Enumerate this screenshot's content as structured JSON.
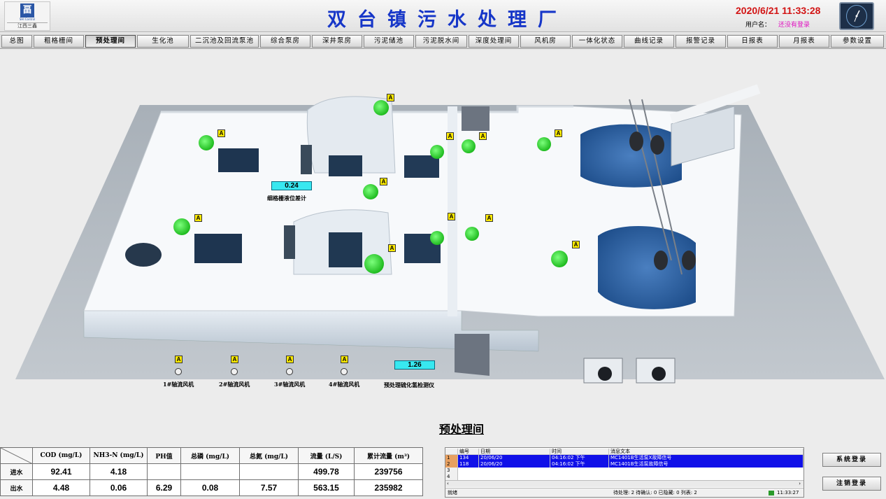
{
  "header": {
    "logo_sub": "SHI Control",
    "logo_name": "江西三鑫",
    "title": "双台镇污水处理厂",
    "datetime": "2020/6/21 11:33:28",
    "user_label": "用户名：",
    "user_value": "还没有登录"
  },
  "nav": [
    {
      "label": "总图",
      "active": false
    },
    {
      "label": "粗格栅间",
      "active": false
    },
    {
      "label": "预处理间",
      "active": true
    },
    {
      "label": "生化池",
      "active": false
    },
    {
      "label": "二沉池及回流泵池",
      "active": false
    },
    {
      "label": "综合泵房",
      "active": false
    },
    {
      "label": "深井泵房",
      "active": false
    },
    {
      "label": "污泥储池",
      "active": false
    },
    {
      "label": "污泥脱水间",
      "active": false
    },
    {
      "label": "深度处理间",
      "active": false
    },
    {
      "label": "风机房",
      "active": false
    },
    {
      "label": "一体化状态",
      "active": false
    },
    {
      "label": "曲线记录",
      "active": false
    },
    {
      "label": "报警记录",
      "active": false
    },
    {
      "label": "日报表",
      "active": false
    },
    {
      "label": "月报表",
      "active": false
    },
    {
      "label": "参数设置",
      "active": false
    }
  ],
  "scene": {
    "alarm_badge": "A",
    "level_diff_value": "0.24",
    "level_diff_label": "细格栅液位差计",
    "h2s_value": "1.26",
    "h2s_label": "预处理硫化氢检测仪",
    "fans": [
      {
        "label": "1#轴流风机"
      },
      {
        "label": "2#轴流风机"
      },
      {
        "label": "3#轴流风机"
      },
      {
        "label": "4#轴流风机"
      }
    ],
    "page_title": "预处理间"
  },
  "water_quality": {
    "headers": [
      "COD (mg/L)",
      "NH3-N (mg/L)",
      "PH值",
      "总磷 (mg/L)",
      "总氮 (mg/L)",
      "流量 (L/S)",
      "累计流量 (m³)"
    ],
    "rows": [
      {
        "label": "进水",
        "values": [
          "92.41",
          "4.18",
          "",
          "",
          "",
          "499.78",
          "239756"
        ]
      },
      {
        "label": "出水",
        "values": [
          "4.48",
          "0.06",
          "6.29",
          "0.08",
          "7.57",
          "563.15",
          "235982"
        ]
      }
    ]
  },
  "alarm_list": {
    "columns": [
      "编号",
      "日期",
      "时间",
      "消息文本"
    ],
    "rows": [
      {
        "num": "1",
        "id": "134",
        "date": "20/06/20",
        "time": "04:16:02 下午",
        "msg": "MC1401B生活泵X故障信号"
      },
      {
        "num": "2",
        "id": "118",
        "date": "20/06/20",
        "time": "04:16:02 下午",
        "msg": "MC1401B生活泵故障信号"
      },
      {
        "num": "3",
        "id": "",
        "date": "",
        "time": "",
        "msg": ""
      },
      {
        "num": "4",
        "id": "",
        "date": "",
        "time": "",
        "msg": ""
      }
    ],
    "status_ready": "就绪",
    "status_counts": "待处理: 2  待确认: 0  已隐藏: 0  列表: 2",
    "status_time": "11:33:27"
  },
  "side_buttons": {
    "login": "系统登录",
    "logout": "注销登录"
  },
  "colors": {
    "title_blue": "#1636c8",
    "datetime_red": "#d21414",
    "motor_green": "#22dd22",
    "value_cyan": "#38e8f0",
    "alarm_yellow": "#ffea00",
    "selected_row": "#1010e8"
  }
}
